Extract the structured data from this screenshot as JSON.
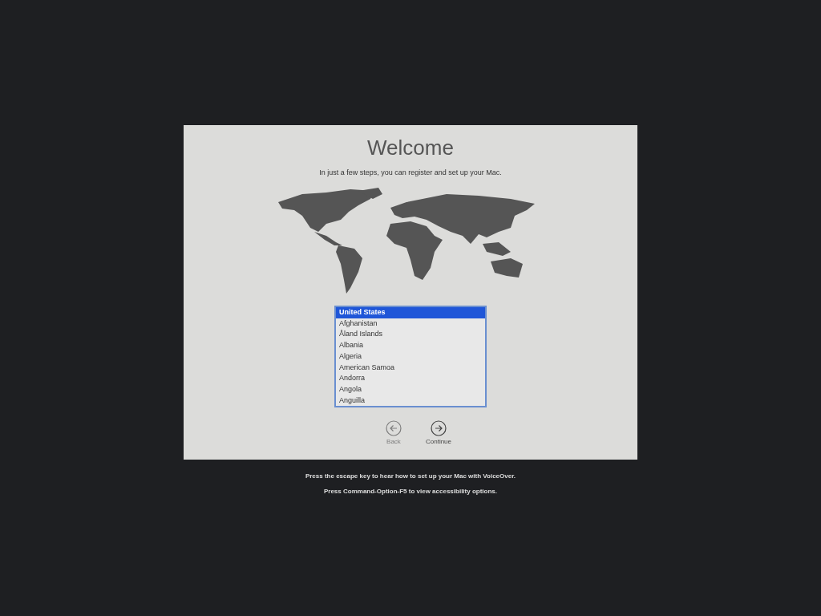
{
  "setup": {
    "title": "Welcome",
    "subtitle": "In just a few steps, you can register and set up your Mac.",
    "countries": [
      {
        "label": "United States",
        "selected": true
      },
      {
        "label": "Afghanistan",
        "selected": false
      },
      {
        "label": "Åland Islands",
        "selected": false
      },
      {
        "label": "Albania",
        "selected": false
      },
      {
        "label": "Algeria",
        "selected": false
      },
      {
        "label": "American Samoa",
        "selected": false
      },
      {
        "label": "Andorra",
        "selected": false
      },
      {
        "label": "Angola",
        "selected": false
      },
      {
        "label": "Anguilla",
        "selected": false
      }
    ],
    "buttons": [
      {
        "label": "Back",
        "kind": "back",
        "disabled": true
      },
      {
        "label": "Continue",
        "kind": "forward",
        "disabled": false
      }
    ]
  },
  "hints": [
    "Press the escape key to hear how to set up your Mac with VoiceOver.",
    "Press Command-Option-F5 to view accessibility options."
  ]
}
